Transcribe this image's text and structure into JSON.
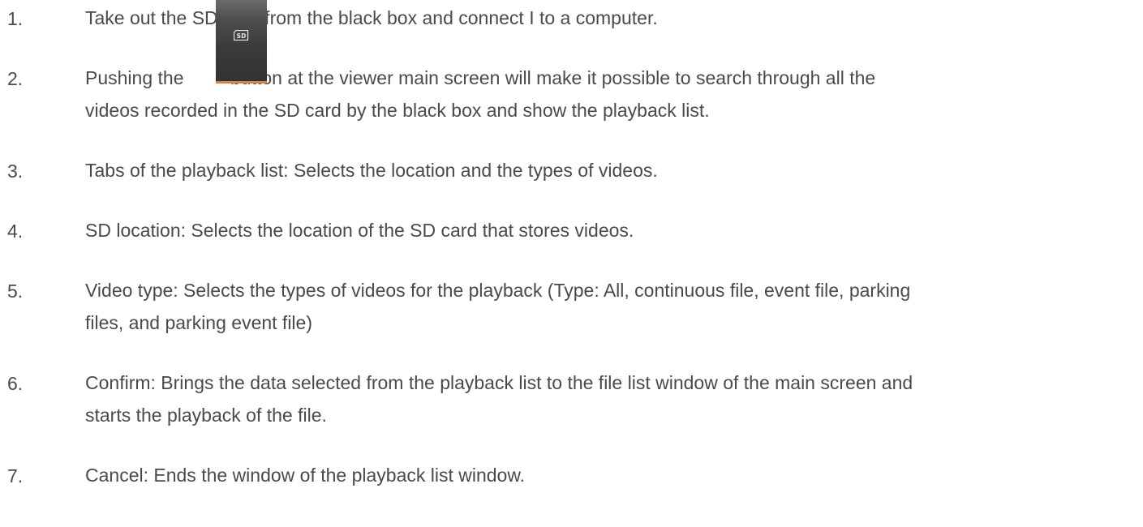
{
  "steps": [
    {
      "number": "1.",
      "lines": [
        "Take out the SD card from the black box and connect I to a computer."
      ]
    },
    {
      "number": "2.",
      "lines": [
        "Pushing the         button at the viewer main screen will make it possible to search through all the",
        "videos recorded in the SD card by the black box and show the playback list."
      ]
    },
    {
      "number": "3.",
      "lines": [
        "Tabs of the playback list: Selects the location and the types of videos."
      ]
    },
    {
      "number": "4.",
      "lines": [
        "SD location: Selects the location of the SD card that stores videos."
      ]
    },
    {
      "number": "5.",
      "lines": [
        "Video type: Selects the types of videos for the playback (Type: All, continuous file, event file, parking",
        "files, and parking event file)"
      ]
    },
    {
      "number": "6.",
      "lines": [
        "Confirm: Brings the data selected from the playback list to the file list window of the main screen and",
        "starts the playback of the file."
      ]
    },
    {
      "number": "7.",
      "lines": [
        "Cancel: Ends the window of the playback list window."
      ]
    }
  ],
  "sd_button": {
    "icon": "sd-card-icon",
    "icon_text": "SD",
    "accent": "#c8875a"
  }
}
